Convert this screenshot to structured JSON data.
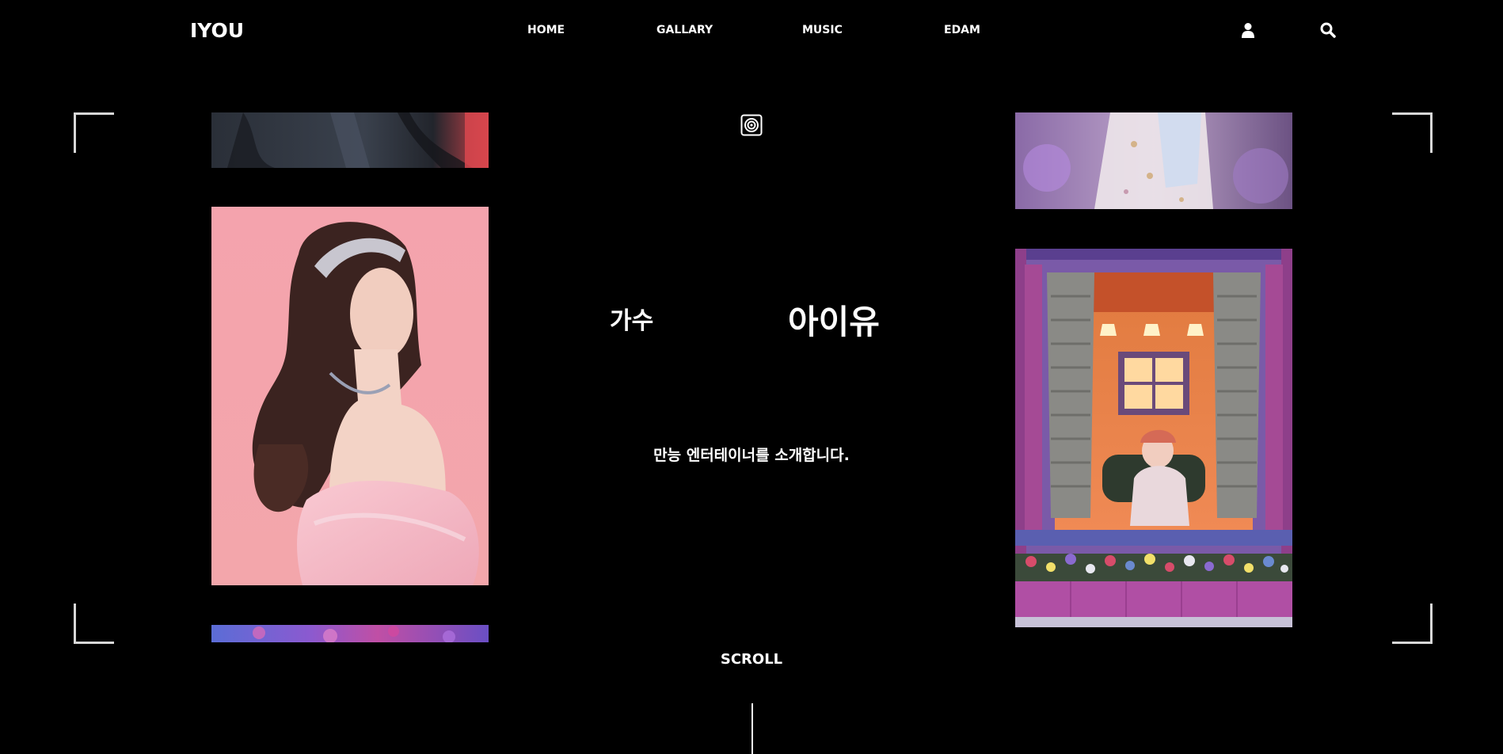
{
  "header": {
    "logo": "IYOU",
    "nav": [
      {
        "label": "HOME"
      },
      {
        "label": "GALLARY"
      },
      {
        "label": "MUSIC"
      },
      {
        "label": "EDAM"
      }
    ],
    "icons": [
      "user-icon",
      "search-icon"
    ]
  },
  "hero": {
    "job": "가수",
    "name": "아이유",
    "intro": "만능 엔터테이너를 소개합니다.",
    "scroll": "SCROLL",
    "center_icon": "target-icon"
  },
  "gallery": {
    "left": [
      "photo-dark-jacket",
      "photo-pink-portrait",
      "photo-flowers"
    ],
    "right": [
      "photo-floral-dress",
      "photo-window-scene"
    ]
  },
  "colors": {
    "background": "#000000",
    "text": "#ffffff",
    "corner": "#d8d8d8",
    "pink": "#f4a7ae"
  }
}
